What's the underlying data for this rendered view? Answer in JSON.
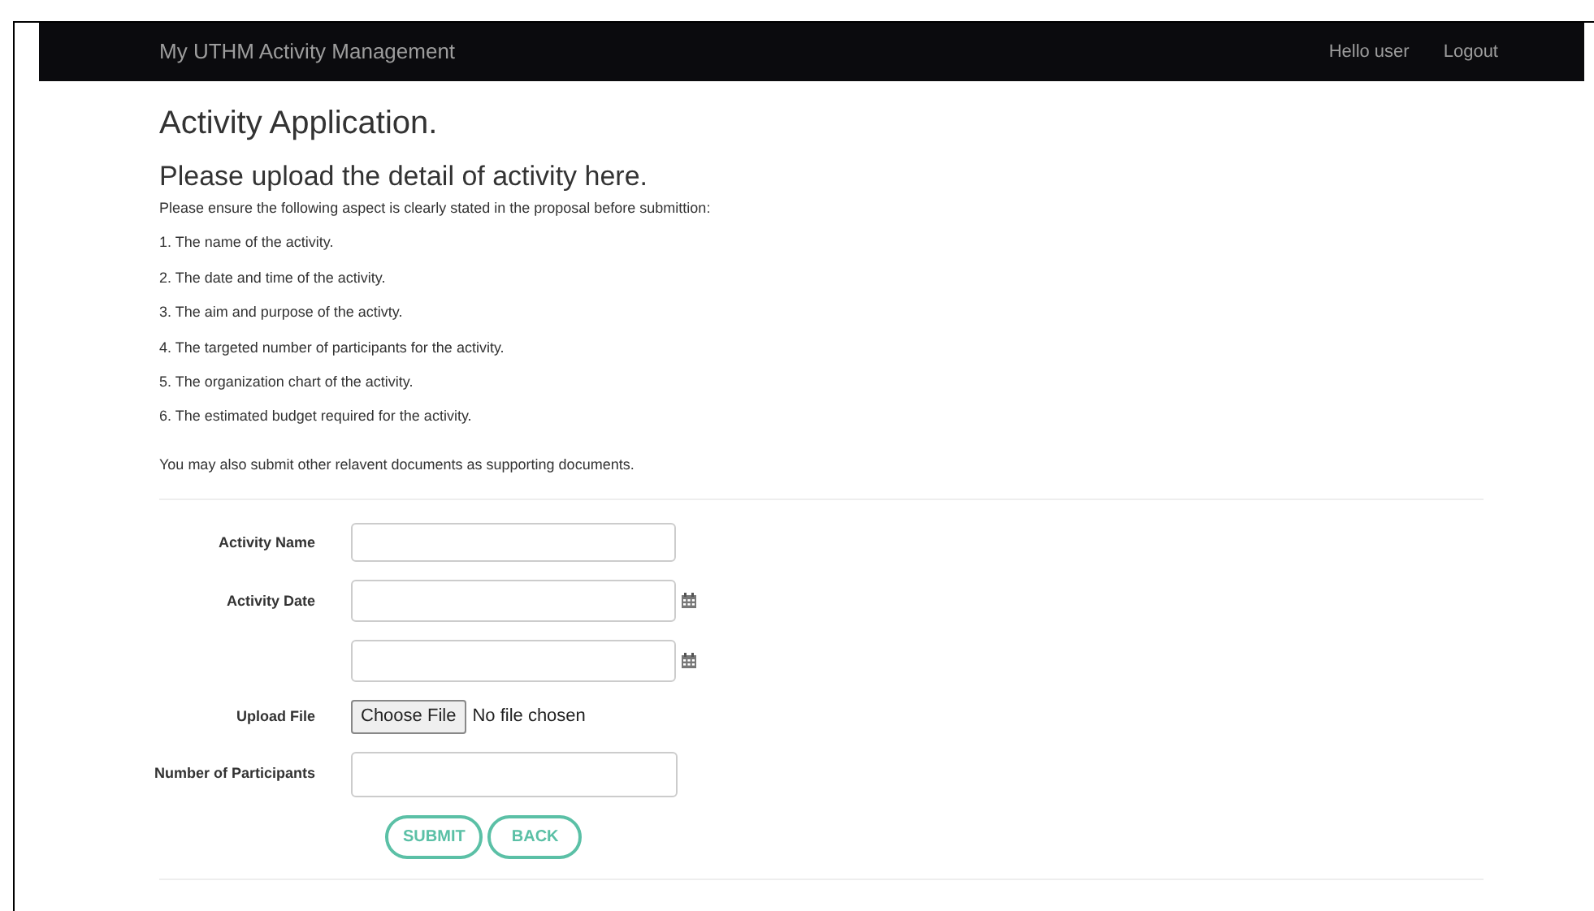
{
  "navbar": {
    "brand": "My UTHM Activity Management",
    "links": [
      "Hello user",
      "Logout"
    ]
  },
  "title": "Activity Application.",
  "subtitle": "Please upload the detail of activity here.",
  "intro": "Please ensure the following aspect is clearly stated in the proposal before submittion:",
  "requirements": [
    "1. The name of the activity.",
    "2. The date and time of the activity.",
    "3. The aim and purpose of the activty.",
    "4. The targeted number of participants for the activity.",
    "5. The organization chart of the activity.",
    "6. The estimated budget required for the activity."
  ],
  "note": "You may also submit other relavent documents as supporting documents.",
  "form": {
    "fields": [
      {
        "label": "Activity Name",
        "kind": "text"
      },
      {
        "label": "Activity Date",
        "kind": "date"
      },
      {
        "kind": "date"
      },
      {
        "label": "Upload File",
        "kind": "file",
        "button": "Choose File",
        "status": "No file chosen"
      },
      {
        "label": "Number of Participants",
        "kind": "number"
      }
    ],
    "buttons": [
      "SUBMIT",
      "BACK"
    ]
  }
}
